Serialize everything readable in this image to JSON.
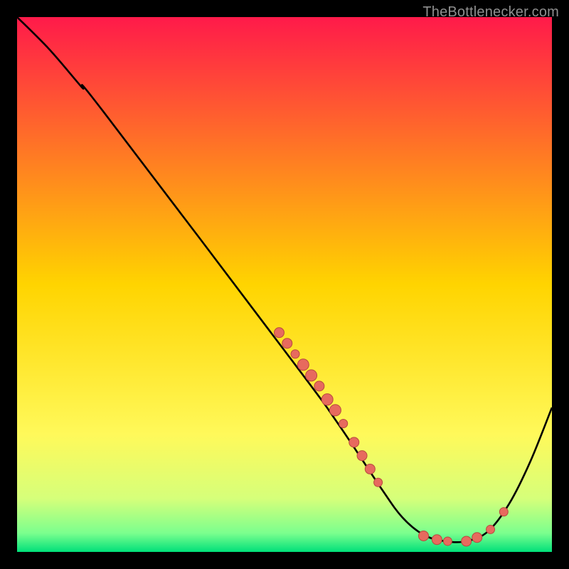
{
  "watermark": "TheBottlenecker.com",
  "chart_data": {
    "type": "line",
    "title": "",
    "xlabel": "",
    "ylabel": "",
    "xlim": [
      0,
      100
    ],
    "ylim": [
      0,
      100
    ],
    "background_gradient": {
      "stops": [
        {
          "offset": 0.0,
          "color": "#ff1a4a"
        },
        {
          "offset": 0.5,
          "color": "#ffd400"
        },
        {
          "offset": 0.78,
          "color": "#fff95a"
        },
        {
          "offset": 0.9,
          "color": "#d6ff7a"
        },
        {
          "offset": 0.965,
          "color": "#7bff8e"
        },
        {
          "offset": 1.0,
          "color": "#00e07a"
        }
      ]
    },
    "curve": {
      "points": [
        {
          "x": 0,
          "y": 100
        },
        {
          "x": 6,
          "y": 94
        },
        {
          "x": 12,
          "y": 87
        },
        {
          "x": 16,
          "y": 82.5
        },
        {
          "x": 52,
          "y": 35
        },
        {
          "x": 60,
          "y": 24
        },
        {
          "x": 68,
          "y": 12
        },
        {
          "x": 72,
          "y": 6.5
        },
        {
          "x": 76,
          "y": 3.2
        },
        {
          "x": 80,
          "y": 2.0
        },
        {
          "x": 84,
          "y": 2.0
        },
        {
          "x": 88,
          "y": 3.8
        },
        {
          "x": 92,
          "y": 9
        },
        {
          "x": 96,
          "y": 17
        },
        {
          "x": 100,
          "y": 27
        }
      ]
    },
    "scatter_points": [
      {
        "x": 49,
        "y": 41,
        "r": 7
      },
      {
        "x": 50.5,
        "y": 39,
        "r": 7
      },
      {
        "x": 52,
        "y": 37,
        "r": 6
      },
      {
        "x": 53.5,
        "y": 35,
        "r": 8
      },
      {
        "x": 55,
        "y": 33,
        "r": 8
      },
      {
        "x": 56.5,
        "y": 31,
        "r": 7
      },
      {
        "x": 58,
        "y": 28.5,
        "r": 8
      },
      {
        "x": 59.5,
        "y": 26.5,
        "r": 8
      },
      {
        "x": 61,
        "y": 24,
        "r": 6
      },
      {
        "x": 63,
        "y": 20.5,
        "r": 7
      },
      {
        "x": 64.5,
        "y": 18,
        "r": 7
      },
      {
        "x": 66,
        "y": 15.5,
        "r": 7
      },
      {
        "x": 67.5,
        "y": 13,
        "r": 6
      },
      {
        "x": 76,
        "y": 3.0,
        "r": 7
      },
      {
        "x": 78.5,
        "y": 2.3,
        "r": 7
      },
      {
        "x": 80.5,
        "y": 2.0,
        "r": 6
      },
      {
        "x": 84,
        "y": 2.0,
        "r": 7
      },
      {
        "x": 86,
        "y": 2.7,
        "r": 7
      },
      {
        "x": 88.5,
        "y": 4.2,
        "r": 6
      },
      {
        "x": 91,
        "y": 7.5,
        "r": 6
      }
    ],
    "colors": {
      "curve": "#000000",
      "point_fill": "#e76a5e",
      "point_stroke": "#b84a3e"
    }
  }
}
